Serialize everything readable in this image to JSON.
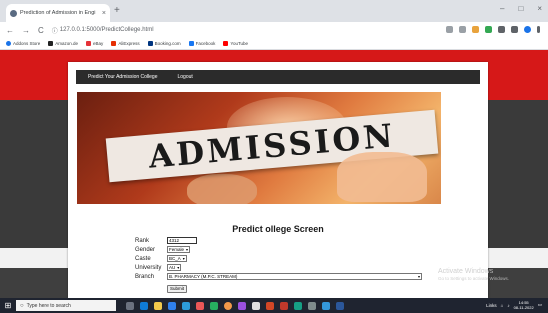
{
  "browser": {
    "tab_title": "Prediction of Admission in Engi",
    "tab_close": "×",
    "new_tab": "+",
    "url": "127.0.0.1:5000/PredictCollege.html",
    "window_controls": {
      "minimize": "‒",
      "maximize": "□",
      "close": "×"
    },
    "nav": {
      "back": "←",
      "forward": "→",
      "reload": "C"
    },
    "bookmarks": [
      {
        "label": "Addons Store",
        "color": "#1a73e8"
      },
      {
        "label": "Amazon.de",
        "color": "#222222"
      },
      {
        "label": "eBay",
        "color": "#e53238"
      },
      {
        "label": "AliExpress",
        "color": "#e62e04"
      },
      {
        "label": "Booking.com",
        "color": "#003580"
      },
      {
        "label": "Facebook",
        "color": "#1877f2"
      },
      {
        "label": "YouTube",
        "color": "#ff0000"
      }
    ]
  },
  "site": {
    "nav_links": [
      "Predict Your Admission College",
      "Logout"
    ],
    "hero_text": "ADMISSION",
    "form_title": "Predict ollege Screen",
    "form": {
      "rank_label": "Rank",
      "rank_value": "4312",
      "gender_label": "Gender",
      "gender_value": "Female",
      "caste_label": "Caste",
      "caste_value": "BC_A",
      "university_label": "University",
      "university_value": "AU",
      "branch_label": "Branch",
      "branch_value": "B. PHARMACY (M.P.C. STREAM)",
      "submit_label": "Submit"
    }
  },
  "watermark": {
    "title": "Activate Windows",
    "subtitle": "Go to Settings to activate Windows."
  },
  "taskbar": {
    "search_placeholder": "Type here to search",
    "tray_links": "Links",
    "time": "14:55",
    "date": "08-11-2022"
  },
  "colors": {
    "header_red": "#d61818",
    "dark_band": "#3a3a3a",
    "nav_bg": "#2b2b2b",
    "taskbar_bg": "#1f2430"
  }
}
